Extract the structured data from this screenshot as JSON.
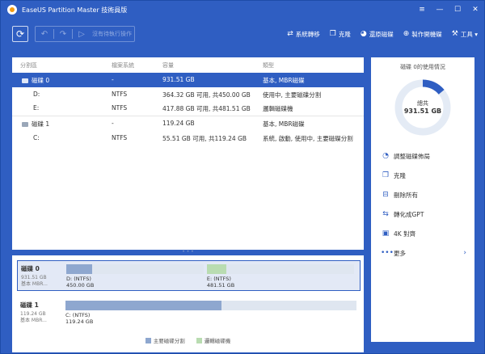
{
  "window": {
    "title": "EaseUS Partition Master 技術員版",
    "controls": [
      "≡",
      "—",
      "☐",
      "✕"
    ]
  },
  "toolbar": {
    "pending_label": "沒有待執行操作",
    "actions": [
      {
        "icon": "⇄",
        "label": "系統轉移"
      },
      {
        "icon": "❐",
        "label": "克隆"
      },
      {
        "icon": "◕",
        "label": "還原磁碟"
      },
      {
        "icon": "⊕",
        "label": "製作開機碟"
      },
      {
        "icon": "⚒",
        "label": "工具 ▾"
      }
    ]
  },
  "table": {
    "headers": [
      "分割區",
      "檔案系統",
      "容量",
      "類型"
    ],
    "rows": [
      {
        "kind": "disk",
        "name": "磁碟 0",
        "fs": "-",
        "capacity": "931.51 GB",
        "type": "基本, MBR磁碟",
        "selected": true
      },
      {
        "kind": "part",
        "name": "D:",
        "fs": "NTFS",
        "capacity": "364.32 GB 可用, 共450.00 GB",
        "type": "使用中, 主要磁碟分割"
      },
      {
        "kind": "part",
        "name": "E:",
        "fs": "NTFS",
        "capacity": "417.88 GB 可用, 共481.51 GB",
        "type": "邏輯磁碟機"
      },
      {
        "kind": "disk",
        "name": "磁碟 1",
        "fs": "-",
        "capacity": "119.24 GB",
        "type": "基本, MBR磁碟"
      },
      {
        "kind": "part",
        "name": "C:",
        "fs": "NTFS",
        "capacity": "55.51 GB 可用, 共119.24 GB",
        "type": "系統, 啟動, 使用中, 主要磁碟分割"
      }
    ]
  },
  "diskmap": {
    "disks": [
      {
        "name": "磁碟 0",
        "size": "931.51 GB",
        "type": "基本 MBR...",
        "selected": true,
        "partitions": [
          {
            "name": "D: (NTFS)",
            "size": "450.00 GB",
            "fraction": 0.483,
            "used_fraction": 0.19,
            "color": "#8ea7cf"
          },
          {
            "name": "E: (NTFS)",
            "size": "481.51 GB",
            "fraction": 0.517,
            "used_fraction": 0.13,
            "color": "#b9dcb1"
          }
        ]
      },
      {
        "name": "磁碟 1",
        "size": "119.24 GB",
        "type": "基本 MBR...",
        "selected": false,
        "partitions": [
          {
            "name": "C: (NTFS)",
            "size": "119.24 GB",
            "fraction": 1.0,
            "used_fraction": 0.535,
            "color": "#8ea7cf"
          }
        ]
      }
    ],
    "legend": [
      {
        "label": "主要磁碟分割",
        "color": "#8ea7cf"
      },
      {
        "label": "邏輯磁碟機",
        "color": "#b9dcb1"
      }
    ]
  },
  "side": {
    "title": "磁碟 0的使用情況",
    "donut_label": "總共",
    "donut_value": "931.51 GB",
    "used_fraction": 0.14,
    "colors": {
      "track": "#e4ebf5",
      "used": "#2f5ec2"
    },
    "items": [
      {
        "icon": "◔",
        "label": "調整磁碟佈局"
      },
      {
        "icon": "❐",
        "label": "克隆"
      },
      {
        "icon": "⊟",
        "label": "刪除所有"
      },
      {
        "icon": "⇆",
        "label": "轉化成GPT"
      },
      {
        "icon": "▣",
        "label": "4K 對齊"
      },
      {
        "icon": "•••",
        "label": "更多"
      }
    ]
  }
}
